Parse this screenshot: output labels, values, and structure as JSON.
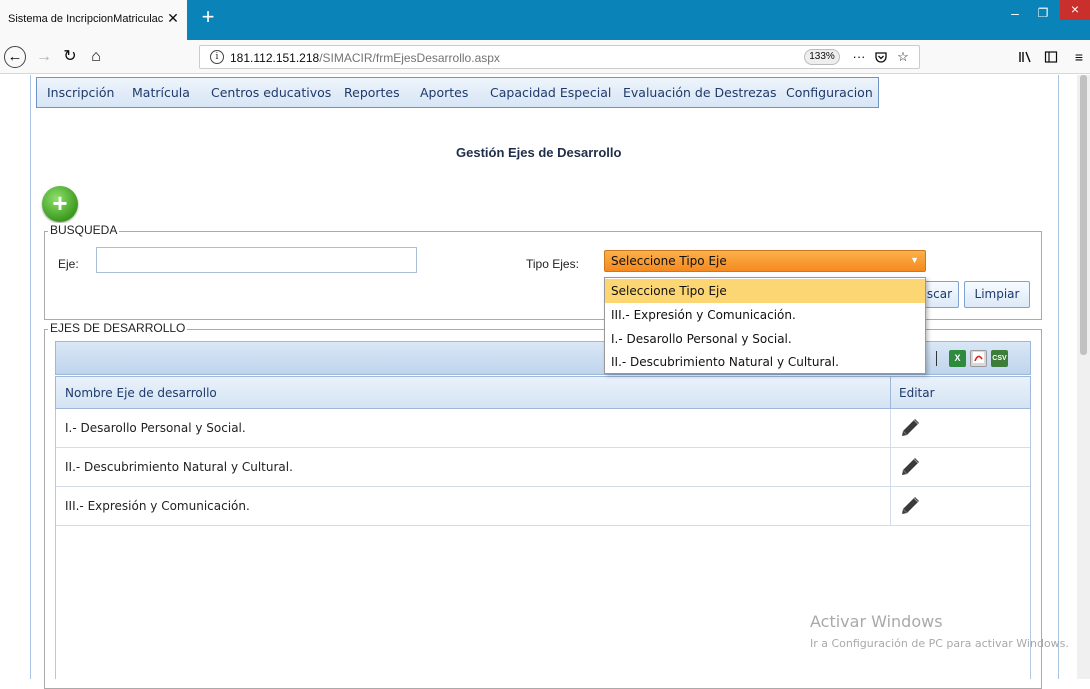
{
  "browser": {
    "tab_title": "Sistema de IncripcionMatriculación",
    "tab_close": "✕",
    "new_tab": "+",
    "url_host": "181.112.151.218",
    "url_path": "/SIMACIR/frmEjesDesarrollo.aspx",
    "zoom": "133%",
    "more_dots": "···"
  },
  "menu": {
    "items": [
      "Inscripción",
      "Matrícula",
      "Centros educativos",
      "Reportes",
      "Aportes",
      "Capacidad Especial",
      "Evaluación de Destrezas",
      "Configuracion"
    ]
  },
  "page": {
    "title": "Gestión Ejes de Desarrollo"
  },
  "busqueda": {
    "legend": "BUSQUEDA",
    "eje_label": "Eje:",
    "eje_value": "",
    "tipo_label": "Tipo Ejes:",
    "tipo_selected": "Seleccione Tipo Eje",
    "buscar_label": "scar",
    "limpiar_label": "Limpiar"
  },
  "dropdown": {
    "options": [
      "Seleccione Tipo Eje",
      "III.- Expresión y Comunicación.",
      "I.- Desarollo Personal y Social.",
      "II.- Descubrimiento Natural y Cultural."
    ],
    "highlighted": 0
  },
  "ejes": {
    "legend": "EJES DE DESARROLLO",
    "col_name": "Nombre Eje de desarrollo",
    "col_edit": "Editar",
    "export_icons": [
      "excel-icon",
      "pdf-icon",
      "csv-icon"
    ],
    "rows": [
      {
        "name": "I.- Desarollo Personal y Social."
      },
      {
        "name": "II.- Descubrimiento Natural y Cultural."
      },
      {
        "name": "III.- Expresión y Comunicación."
      }
    ]
  },
  "watermark": {
    "line1": "Activar Windows",
    "line2": "Ir a Configuración de PC para activar Windows."
  },
  "colors": {
    "chrome_blue": "#0a84b8",
    "select_orange": "#f58a1f",
    "dropdown_highlight": "#fdd674",
    "grid_header": "#d4e3f3"
  }
}
